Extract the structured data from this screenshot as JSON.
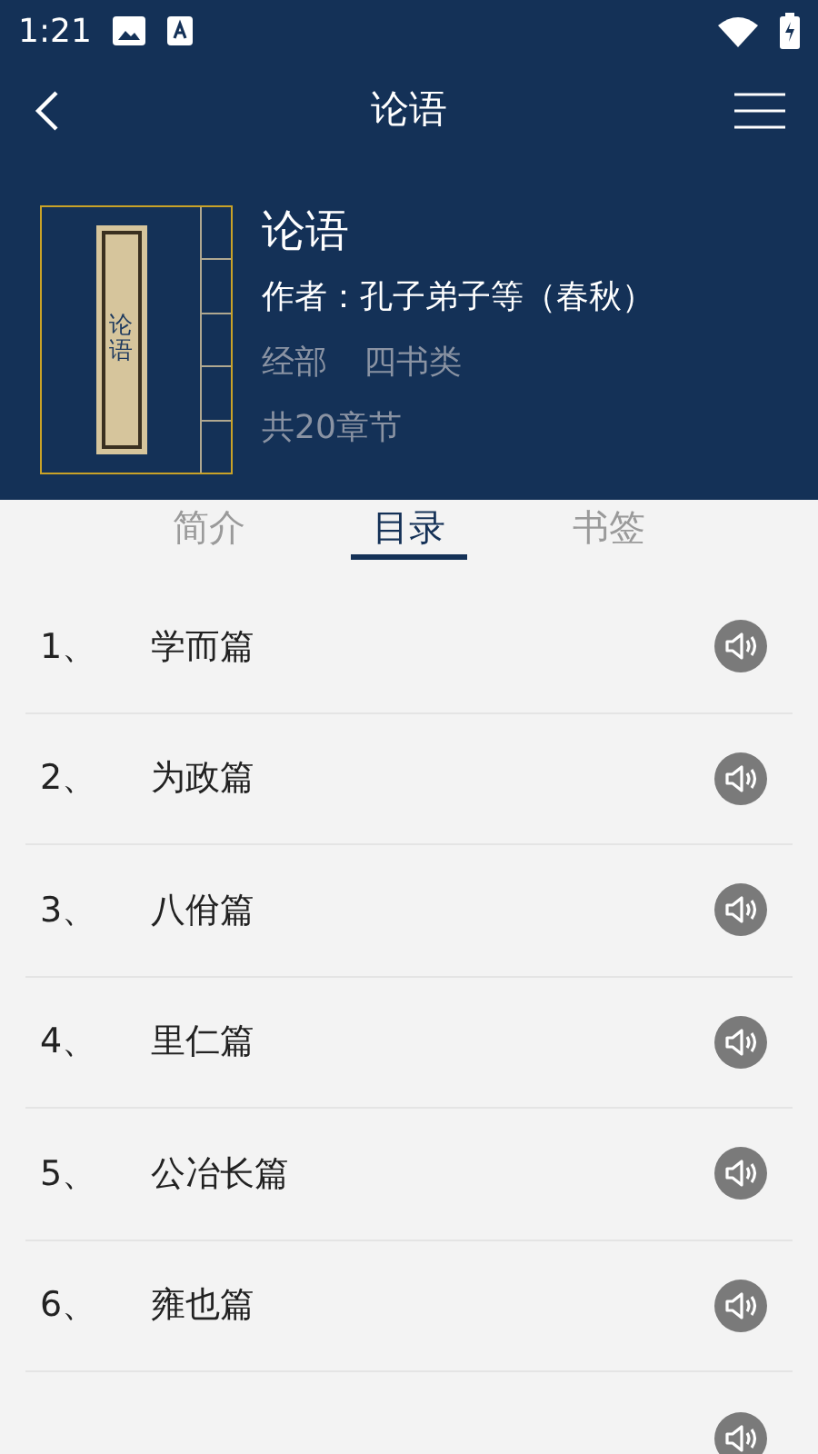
{
  "status_bar": {
    "time": "1:21"
  },
  "nav": {
    "title": "论语"
  },
  "book": {
    "cover_label": "论语",
    "title": "论语",
    "author": "作者：孔子弟子等（春秋）",
    "category": "经部",
    "subcategory": "四书类",
    "chapters": "共20章节"
  },
  "tabs": [
    {
      "label": "简介",
      "selected": false
    },
    {
      "label": "目录",
      "selected": true
    },
    {
      "label": "书签",
      "selected": false
    }
  ],
  "chapters": [
    {
      "number": "1、",
      "title": "学而篇"
    },
    {
      "number": "2、",
      "title": "为政篇"
    },
    {
      "number": "3、",
      "title": "八佾篇"
    },
    {
      "number": "4、",
      "title": "里仁篇"
    },
    {
      "number": "5、",
      "title": "公冶长篇"
    },
    {
      "number": "6、",
      "title": "雍也篇"
    }
  ]
}
